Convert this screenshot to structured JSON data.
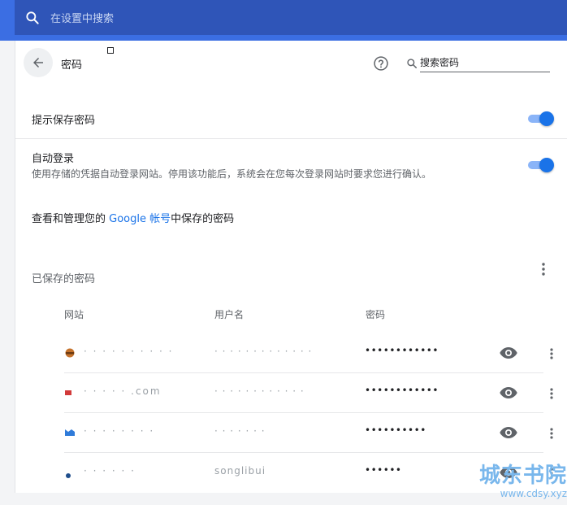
{
  "top_search": {
    "placeholder": "在设置中搜索"
  },
  "header": {
    "title": "密码",
    "search_placeholder": "搜索密码"
  },
  "settings": {
    "offer_to_save": {
      "label": "提示保存密码",
      "enabled": true
    },
    "auto_signin": {
      "label": "自动登录",
      "description": "使用存储的凭据自动登录网站。停用该功能后，系统会在您每次登录网站时要求您进行确认。",
      "enabled": true
    },
    "manage_link": {
      "prefix": "查看和管理您的 ",
      "link_text": "Google 帐号",
      "suffix": "中保存的密码"
    }
  },
  "saved": {
    "title": "已保存的密码",
    "columns": {
      "site": "网站",
      "username": "用户名",
      "password": "密码"
    },
    "rows": [
      {
        "site": "·  · · · ·  · · ·  · ·",
        "username": "· · · · · · · · · · · · ·",
        "password": "••••••••••••",
        "favicon_color": "#c5722b"
      },
      {
        "site": "· ·  · · · .com",
        "username": "· · · ·  · · · · · · · ·",
        "password": "••••••••••••",
        "favicon_color": "#d23a3a"
      },
      {
        "site": "· · · · · · · ·",
        "username": "· · · · · · ·",
        "password": "••••••••••",
        "favicon_color": "#2f7bd9"
      },
      {
        "site": "· · · · · ·",
        "username": "songlibui",
        "password": "••••••",
        "favicon_color": "#1f4e8c"
      }
    ]
  },
  "watermark": {
    "main": "城东书院",
    "url": "www.cdsy.xyz"
  },
  "colors": {
    "accent": "#1a73e8",
    "topbar": "#3b6ee3",
    "searchbar": "#2f55b8"
  }
}
